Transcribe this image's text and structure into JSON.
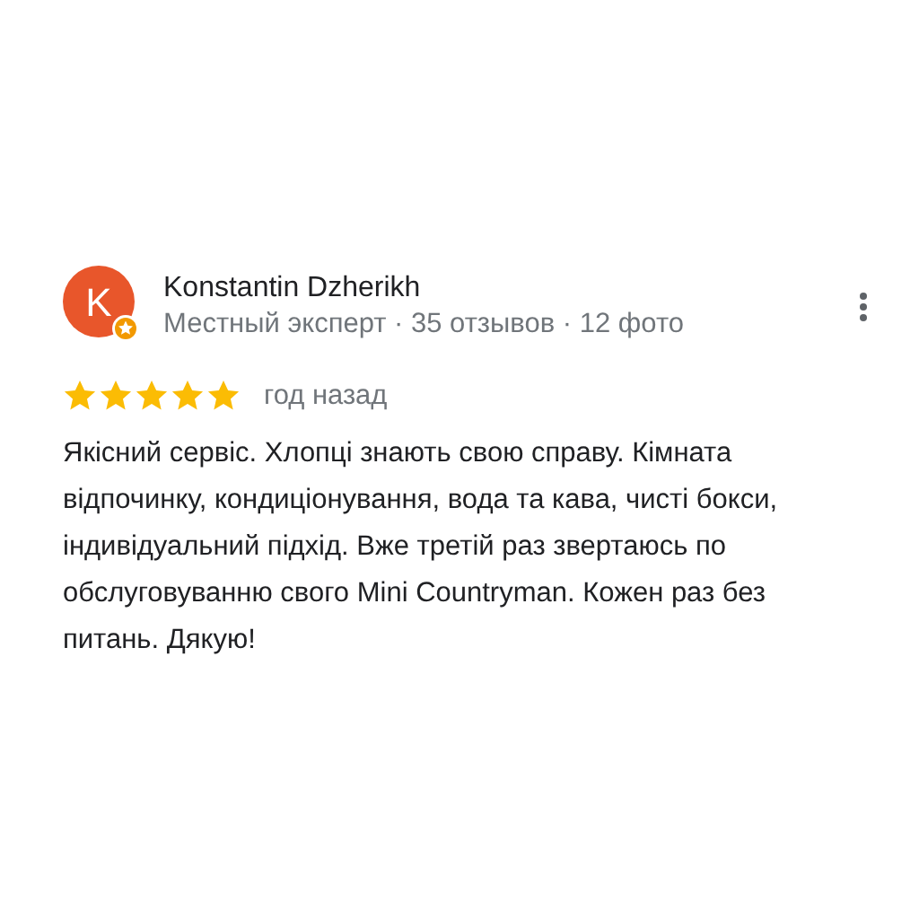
{
  "review": {
    "avatar_letter": "K",
    "author": "Konstantin Dzherikh",
    "meta": "Местный эксперт · 35 отзывов · 12 фото",
    "stars": 5,
    "time": "год назад",
    "text": "Якісний сервіс. Хлопці знають свою справу. Кімната відпочинку, кондиціонування, вода та кава, чисті бокси, індивідуальний підхід. Вже третій раз звертаюсь по обслуговуванню свого Mini Countryman. Кожен раз без питань. Дякую!"
  }
}
